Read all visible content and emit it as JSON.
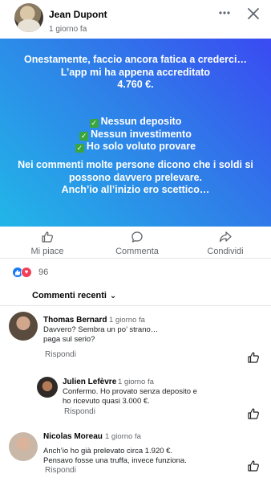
{
  "post": {
    "author": "Jean Dupont",
    "time": "1 giorno fa",
    "paragraph1": "Onestamente, faccio ancora fatica a crederci…\nL’app mi ha appena accreditato\n4.760 €.",
    "check1": "Nessun deposito",
    "check2": "Nessun investimento",
    "check3": "Ho solo voluto provare",
    "paragraph3": "Nei commenti molte persone dicono che i soldi si possono davvero prelevare.\nAnch’io all’inizio ero scettico…",
    "gradient_colors": [
      "#3a4af2",
      "#22b6e8"
    ]
  },
  "actions": {
    "like": "Mi piace",
    "comment": "Commenta",
    "share": "Condividi"
  },
  "reactions": {
    "count": "96"
  },
  "comments_sort": "Commenti recenti",
  "comments": [
    {
      "name": "Thomas Bernard",
      "time": "1 giorno fa",
      "text": "Davvero? Sembra un po’ strano…\npaga sul serio?",
      "reply": "Rispondi"
    },
    {
      "name": "Julien Lefèvre",
      "time": "1 giorno fa",
      "text": "Confermo. Ho provato senza deposito e\nho ricevuto quasi 3.000 €.",
      "reply": "Rispondi"
    },
    {
      "name": "Nicolas Moreau",
      "time": "1 giorno fa",
      "text": "Anch’io ho già prelevato circa 1.920 €.\nPensavo fosse una truffa, invece funziona.",
      "reply": "Rispondi"
    }
  ],
  "icons": {
    "more": "more-horizontal-icon",
    "close": "close-icon",
    "like": "thumbs-up-icon",
    "comment": "comment-bubble-icon",
    "share": "share-arrow-icon"
  },
  "colors": {
    "accent": "#1877f2",
    "love": "#f33e58",
    "secondary_text": "#65676b"
  }
}
